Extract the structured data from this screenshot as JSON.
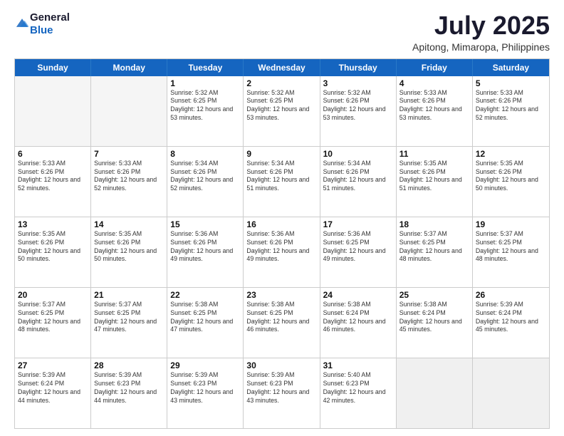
{
  "logo": {
    "line1": "General",
    "line2": "Blue"
  },
  "header": {
    "month": "July 2025",
    "location": "Apitong, Mimaropa, Philippines"
  },
  "days_of_week": [
    "Sunday",
    "Monday",
    "Tuesday",
    "Wednesday",
    "Thursday",
    "Friday",
    "Saturday"
  ],
  "weeks": [
    [
      {
        "day": "",
        "info": "",
        "empty": true
      },
      {
        "day": "",
        "info": "",
        "empty": true
      },
      {
        "day": "1",
        "info": "Sunrise: 5:32 AM\nSunset: 6:25 PM\nDaylight: 12 hours and 53 minutes."
      },
      {
        "day": "2",
        "info": "Sunrise: 5:32 AM\nSunset: 6:25 PM\nDaylight: 12 hours and 53 minutes."
      },
      {
        "day": "3",
        "info": "Sunrise: 5:32 AM\nSunset: 6:26 PM\nDaylight: 12 hours and 53 minutes."
      },
      {
        "day": "4",
        "info": "Sunrise: 5:33 AM\nSunset: 6:26 PM\nDaylight: 12 hours and 53 minutes."
      },
      {
        "day": "5",
        "info": "Sunrise: 5:33 AM\nSunset: 6:26 PM\nDaylight: 12 hours and 52 minutes."
      }
    ],
    [
      {
        "day": "6",
        "info": "Sunrise: 5:33 AM\nSunset: 6:26 PM\nDaylight: 12 hours and 52 minutes."
      },
      {
        "day": "7",
        "info": "Sunrise: 5:33 AM\nSunset: 6:26 PM\nDaylight: 12 hours and 52 minutes."
      },
      {
        "day": "8",
        "info": "Sunrise: 5:34 AM\nSunset: 6:26 PM\nDaylight: 12 hours and 52 minutes."
      },
      {
        "day": "9",
        "info": "Sunrise: 5:34 AM\nSunset: 6:26 PM\nDaylight: 12 hours and 51 minutes."
      },
      {
        "day": "10",
        "info": "Sunrise: 5:34 AM\nSunset: 6:26 PM\nDaylight: 12 hours and 51 minutes."
      },
      {
        "day": "11",
        "info": "Sunrise: 5:35 AM\nSunset: 6:26 PM\nDaylight: 12 hours and 51 minutes."
      },
      {
        "day": "12",
        "info": "Sunrise: 5:35 AM\nSunset: 6:26 PM\nDaylight: 12 hours and 50 minutes."
      }
    ],
    [
      {
        "day": "13",
        "info": "Sunrise: 5:35 AM\nSunset: 6:26 PM\nDaylight: 12 hours and 50 minutes."
      },
      {
        "day": "14",
        "info": "Sunrise: 5:35 AM\nSunset: 6:26 PM\nDaylight: 12 hours and 50 minutes."
      },
      {
        "day": "15",
        "info": "Sunrise: 5:36 AM\nSunset: 6:26 PM\nDaylight: 12 hours and 49 minutes."
      },
      {
        "day": "16",
        "info": "Sunrise: 5:36 AM\nSunset: 6:26 PM\nDaylight: 12 hours and 49 minutes."
      },
      {
        "day": "17",
        "info": "Sunrise: 5:36 AM\nSunset: 6:25 PM\nDaylight: 12 hours and 49 minutes."
      },
      {
        "day": "18",
        "info": "Sunrise: 5:37 AM\nSunset: 6:25 PM\nDaylight: 12 hours and 48 minutes."
      },
      {
        "day": "19",
        "info": "Sunrise: 5:37 AM\nSunset: 6:25 PM\nDaylight: 12 hours and 48 minutes."
      }
    ],
    [
      {
        "day": "20",
        "info": "Sunrise: 5:37 AM\nSunset: 6:25 PM\nDaylight: 12 hours and 48 minutes."
      },
      {
        "day": "21",
        "info": "Sunrise: 5:37 AM\nSunset: 6:25 PM\nDaylight: 12 hours and 47 minutes."
      },
      {
        "day": "22",
        "info": "Sunrise: 5:38 AM\nSunset: 6:25 PM\nDaylight: 12 hours and 47 minutes."
      },
      {
        "day": "23",
        "info": "Sunrise: 5:38 AM\nSunset: 6:25 PM\nDaylight: 12 hours and 46 minutes."
      },
      {
        "day": "24",
        "info": "Sunrise: 5:38 AM\nSunset: 6:24 PM\nDaylight: 12 hours and 46 minutes."
      },
      {
        "day": "25",
        "info": "Sunrise: 5:38 AM\nSunset: 6:24 PM\nDaylight: 12 hours and 45 minutes."
      },
      {
        "day": "26",
        "info": "Sunrise: 5:39 AM\nSunset: 6:24 PM\nDaylight: 12 hours and 45 minutes."
      }
    ],
    [
      {
        "day": "27",
        "info": "Sunrise: 5:39 AM\nSunset: 6:24 PM\nDaylight: 12 hours and 44 minutes."
      },
      {
        "day": "28",
        "info": "Sunrise: 5:39 AM\nSunset: 6:23 PM\nDaylight: 12 hours and 44 minutes."
      },
      {
        "day": "29",
        "info": "Sunrise: 5:39 AM\nSunset: 6:23 PM\nDaylight: 12 hours and 43 minutes."
      },
      {
        "day": "30",
        "info": "Sunrise: 5:39 AM\nSunset: 6:23 PM\nDaylight: 12 hours and 43 minutes."
      },
      {
        "day": "31",
        "info": "Sunrise: 5:40 AM\nSunset: 6:23 PM\nDaylight: 12 hours and 42 minutes."
      },
      {
        "day": "",
        "info": "",
        "empty": true,
        "shaded": true
      },
      {
        "day": "",
        "info": "",
        "empty": true,
        "shaded": true
      }
    ]
  ]
}
